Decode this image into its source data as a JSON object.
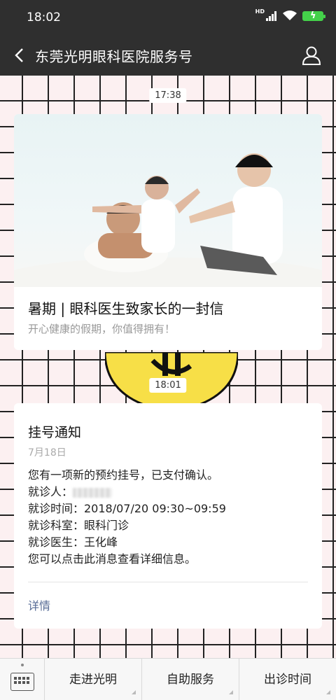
{
  "statusbar": {
    "time": "18:02",
    "network": "HD"
  },
  "navbar": {
    "title": "东莞光明眼科医院服务号"
  },
  "chat": {
    "timestamp1": "17:38",
    "article": {
      "title": "暑期 | 眼科医生致家长的一封信",
      "subtitle": "开心健康的假期，你值得拥有！"
    },
    "timestamp2": "18:01",
    "notice": {
      "title": "挂号通知",
      "date": "7月18日",
      "line1": "您有一项新的预约挂号，已支付确认。",
      "patient_label": "就诊人：",
      "time_line": "就诊时间：2018/07/20 09:30~09:59",
      "dept_line": "就诊科室：眼科门诊",
      "doctor_line": "就诊医生：王化峰",
      "hint_line": "您可以点击此消息查看详细信息。",
      "details": "详情"
    }
  },
  "bottombar": {
    "menus": [
      "走进光明",
      "自助服务",
      "出诊时间"
    ]
  },
  "colors": {
    "bar": "#2f2f2f",
    "link": "#576b95",
    "battery": "#44d14a"
  }
}
